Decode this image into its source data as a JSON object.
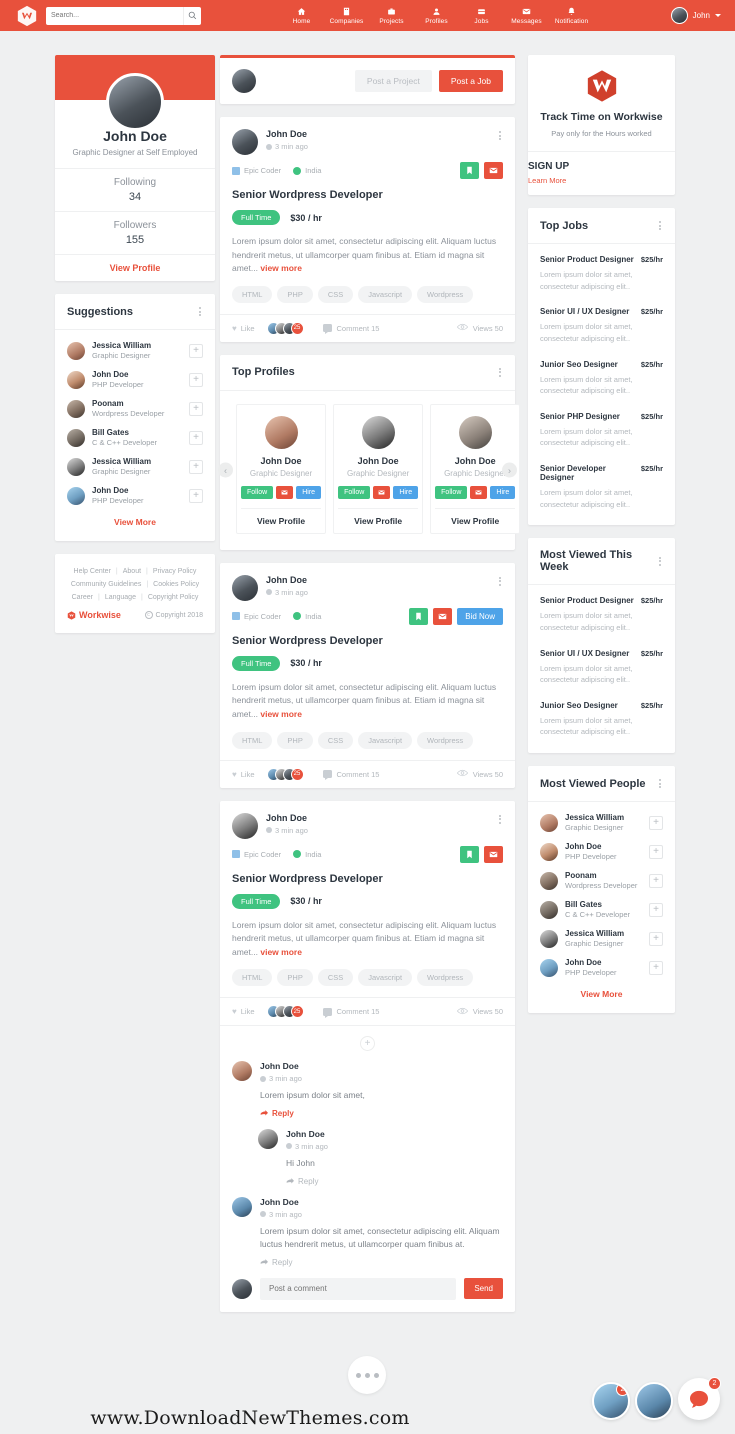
{
  "header": {
    "logo_icon": "workwise-w-logo",
    "search": {
      "placeholder": "Search...",
      "value": "",
      "icon": "search-icon"
    },
    "nav": [
      {
        "label": "Home",
        "icon": "home-icon"
      },
      {
        "label": "Companies",
        "icon": "building-icon"
      },
      {
        "label": "Projects",
        "icon": "briefcase-icon"
      },
      {
        "label": "Profiles",
        "icon": "user-icon"
      },
      {
        "label": "Jobs",
        "icon": "suitcase-icon"
      },
      {
        "label": "Messages",
        "icon": "envelope-icon"
      },
      {
        "label": "Notification",
        "icon": "bell-icon"
      }
    ],
    "user": {
      "name": "John",
      "avatar": "user-avatar",
      "caret": "chevron-down-icon"
    },
    "accent_color": "#e8513c"
  },
  "sidebar_left": {
    "profile": {
      "name": "John Doe",
      "role": "Graphic Designer at Self Employed",
      "stats": [
        {
          "label": "Following",
          "value": "34"
        },
        {
          "label": "Followers",
          "value": "155"
        }
      ],
      "view_profile": "View Profile"
    },
    "suggestions": {
      "title": "Suggestions",
      "items": [
        {
          "name": "Jessica William",
          "role": "Graphic Designer"
        },
        {
          "name": "John Doe",
          "role": "PHP Developer"
        },
        {
          "name": "Poonam",
          "role": "Wordpress Developer"
        },
        {
          "name": "Bill Gates",
          "role": "C & C++ Developer"
        },
        {
          "name": "Jessica William",
          "role": "Graphic Designer"
        },
        {
          "name": "John Doe",
          "role": "PHP Developer"
        }
      ],
      "view_more": "View More",
      "add_icon": "plus-icon"
    },
    "footer": {
      "rows": [
        [
          "Help Center",
          "About",
          "Privacy Policy"
        ],
        [
          "Community Guidelines",
          "Cookies Policy"
        ],
        [
          "Career",
          "Language",
          "Copyright Policy"
        ]
      ],
      "brand": "Workwise",
      "copyright": "Copyright 2018"
    }
  },
  "main": {
    "composer": {
      "post_project_label": "Post a Project",
      "post_job_label": "Post a Job"
    },
    "posts": [
      {
        "author": "John Doe",
        "time": "3 min ago",
        "company": "Epic Coder",
        "location": "India",
        "title": "Senior Wordpress Developer",
        "type": "Full Time",
        "rate": "$30 / hr",
        "description": "Lorem ipsum dolor sit amet, consectetur adipiscing elit. Aliquam luctus hendrerit metus, ut ullamcorper quam finibus at. Etiam id magna sit amet...",
        "view_more": "view more",
        "skills": [
          "HTML",
          "PHP",
          "CSS",
          "Javascript",
          "Wordpress"
        ],
        "like_label": "Like",
        "reaction_count": "25",
        "comment_label": "Comment 15",
        "views_label": "Views 50",
        "has_bid": false,
        "bid_label": ""
      },
      {
        "author": "John Doe",
        "time": "3 min ago",
        "company": "Epic Coder",
        "location": "India",
        "title": "Senior Wordpress Developer",
        "type": "Full Time",
        "rate": "$30 / hr",
        "description": "Lorem ipsum dolor sit amet, consectetur adipiscing elit. Aliquam luctus hendrerit metus, ut ullamcorper quam finibus at. Etiam id magna sit amet...",
        "view_more": "view more",
        "skills": [
          "HTML",
          "PHP",
          "CSS",
          "Javascript",
          "Wordpress"
        ],
        "like_label": "Like",
        "reaction_count": "25",
        "comment_label": "Comment 15",
        "views_label": "Views 50",
        "has_bid": true,
        "bid_label": "Bid Now"
      },
      {
        "author": "John Doe",
        "time": "3 min ago",
        "company": "Epic Coder",
        "location": "India",
        "title": "Senior Wordpress Developer",
        "type": "Full Time",
        "rate": "$30 / hr",
        "description": "Lorem ipsum dolor sit amet, consectetur adipiscing elit. Aliquam luctus hendrerit metus, ut ullamcorper quam finibus at. Etiam id magna sit amet...",
        "view_more": "view more",
        "skills": [
          "HTML",
          "PHP",
          "CSS",
          "Javascript",
          "Wordpress"
        ],
        "like_label": "Like",
        "reaction_count": "25",
        "comment_label": "Comment 15",
        "views_label": "Views 50",
        "has_bid": false,
        "bid_label": ""
      }
    ],
    "top_profiles": {
      "title": "Top Profiles",
      "cards": [
        {
          "name": "John Doe",
          "role": "Graphic Designer",
          "follow": "Follow",
          "hire": "Hire",
          "view_profile": "View Profile"
        },
        {
          "name": "John Doe",
          "role": "Graphic Designer",
          "follow": "Follow",
          "hire": "Hire",
          "view_profile": "View Profile"
        },
        {
          "name": "John Doe",
          "role": "Graphic Designer",
          "follow": "Follow",
          "hire": "Hire",
          "view_profile": "View Profile"
        }
      ],
      "prev_icon": "chevron-left-icon",
      "next_icon": "chevron-right-icon"
    },
    "comments": {
      "expand_icon": "plus-icon",
      "items": [
        {
          "name": "John Doe",
          "time": "3 min ago",
          "text": "Lorem ipsum dolor sit amet,",
          "reply": "Reply",
          "nested": false,
          "active": true
        },
        {
          "name": "John Doe",
          "time": "3 min ago",
          "text": "Hi John",
          "reply": "Reply",
          "nested": true,
          "active": false
        },
        {
          "name": "John Doe",
          "time": "3 min ago",
          "text": "Lorem ipsum dolor sit amet, consectetur adipiscing elit. Aliquam luctus hendrerit metus, ut ullamcorper quam finibus at.",
          "reply": "Reply",
          "nested": false,
          "active": false
        }
      ],
      "input_placeholder": "Post a comment",
      "input_value": "",
      "send_label": "Send"
    }
  },
  "sidebar_right": {
    "promo": {
      "title": "Track Time on Workwise",
      "subtitle": "Pay only for the Hours worked",
      "signup": "SIGN UP",
      "learn_more": "Learn More",
      "logo_icon": "workwise-w-logo"
    },
    "top_jobs": {
      "title": "Top Jobs",
      "items": [
        {
          "name": "Senior Product Designer",
          "rate": "$25/hr",
          "desc": "Lorem ipsum dolor sit amet, consectetur adipiscing elit.."
        },
        {
          "name": "Senior UI / UX Designer",
          "rate": "$25/hr",
          "desc": "Lorem ipsum dolor sit amet, consectetur adipiscing elit.."
        },
        {
          "name": "Junior Seo Designer",
          "rate": "$25/hr",
          "desc": "Lorem ipsum dolor sit amet, consectetur adipiscing elit.."
        },
        {
          "name": "Senior PHP Designer",
          "rate": "$25/hr",
          "desc": "Lorem ipsum dolor sit amet, consectetur adipiscing elit.."
        },
        {
          "name": "Senior Developer Designer",
          "rate": "$25/hr",
          "desc": "Lorem ipsum dolor sit amet, consectetur adipiscing elit.."
        }
      ]
    },
    "most_viewed_week": {
      "title": "Most Viewed This Week",
      "items": [
        {
          "name": "Senior Product Designer",
          "rate": "$25/hr",
          "desc": "Lorem ipsum dolor sit amet, consectetur adipiscing elit.."
        },
        {
          "name": "Senior UI / UX Designer",
          "rate": "$25/hr",
          "desc": "Lorem ipsum dolor sit amet, consectetur adipiscing elit.."
        },
        {
          "name": "Junior Seo Designer",
          "rate": "$25/hr",
          "desc": "Lorem ipsum dolor sit amet, consectetur adipiscing elit.."
        }
      ]
    },
    "most_viewed_people": {
      "title": "Most Viewed People",
      "items": [
        {
          "name": "Jessica William",
          "role": "Graphic Designer"
        },
        {
          "name": "John Doe",
          "role": "PHP Developer"
        },
        {
          "name": "Poonam",
          "role": "Wordpress Developer"
        },
        {
          "name": "Bill Gates",
          "role": "C & C++ Developer"
        },
        {
          "name": "Jessica William",
          "role": "Graphic Designer"
        },
        {
          "name": "John Doe",
          "role": "PHP Developer"
        }
      ],
      "view_more": "View More"
    }
  },
  "bottom": {
    "watermark": "www.DownloadNewThemes.com",
    "chat_badges": [
      "2",
      "2"
    ],
    "chat_icon": "chat-bubble-icon",
    "more_icon": "ellipsis-icon"
  }
}
